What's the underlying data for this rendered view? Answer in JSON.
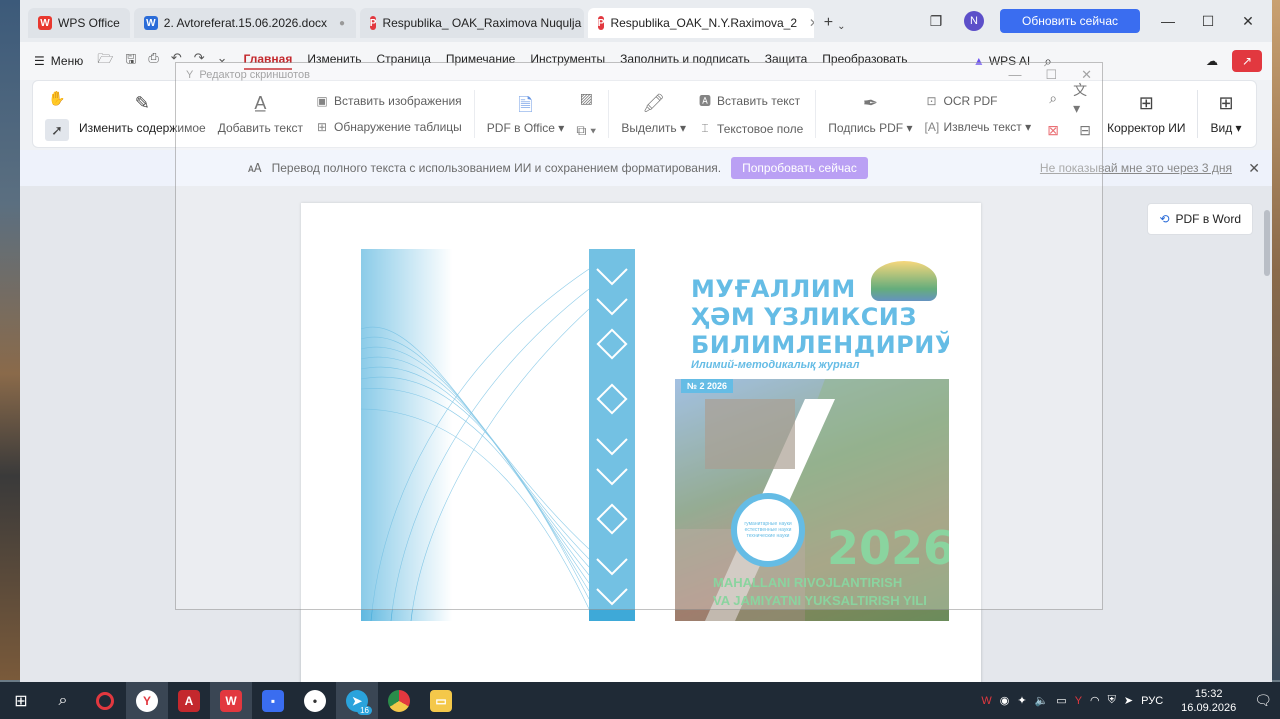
{
  "tabs": [
    {
      "label": "WPS Office",
      "icon": "wps-icon",
      "state": "normal"
    },
    {
      "label": "2. Avtoreferat.15.06.2026.docx",
      "icon": "word-icon",
      "state": "unsaved"
    },
    {
      "label": "Respublika_ OAK_Raximova Nuqulja",
      "icon": "pdf-icon",
      "state": "normal"
    },
    {
      "label": "Respublika_OAK_N.Y.Raximova_2",
      "icon": "pdf-icon",
      "state": "active"
    }
  ],
  "header": {
    "avatar_letter": "N",
    "update_button": "Обновить сейчас"
  },
  "menubar": {
    "menu_label": "Меню",
    "items": [
      "Главная",
      "Изменить",
      "Страница",
      "Примечание",
      "Инструменты",
      "Заполнить и подписать",
      "Защита",
      "Преобразовать"
    ],
    "active_index": 0,
    "wps_ai": "WPS AI"
  },
  "overlay": {
    "title": "Редактор скриншотов"
  },
  "ribbon": {
    "edit_content": "Изменить содержимое",
    "add_text": "Добавить текст",
    "insert_image": "Вставить изображения",
    "detect_table": "Обнаружение таблицы",
    "pdf_to_office": "PDF в Office",
    "select": "Выделить",
    "insert_text": "Вставить текст",
    "text_field": "Текстовое поле",
    "sign_pdf": "Подпись PDF",
    "ocr_pdf": "OCR PDF",
    "extract_text": "Извлечь текст",
    "ai_corrector": "Корректор ИИ",
    "view": "Вид"
  },
  "notification": {
    "message": "Перевод полного текста с использованием ИИ и сохранением форматирования.",
    "try_button": "Попробовать сейчас",
    "hide_link": "Не показывай мне это через 3 дня"
  },
  "side": {
    "pdf_to_word": "PDF в Word"
  },
  "cover": {
    "title_lines": [
      "МУҒАЛЛИМ",
      "ҲӘМ ҮЗЛИКСИЗ",
      "БИЛИМЛЕНДИРИЎ"
    ],
    "subtitle": "Илимий-методикалық журнал",
    "issue": "№ 2 2026",
    "year": "2026",
    "slogan_lines": [
      "MAHALLANI RIVOJLANTIRISH",
      "VA JAMIYATNI YUKSALTIRISH YILI"
    ],
    "badge_text": "гуманитарные науки естественные науки технические науки"
  },
  "taskbar": {
    "lang": "РУС",
    "time": "15:32",
    "date": "16.09.2026",
    "telegram_badge": "16"
  }
}
